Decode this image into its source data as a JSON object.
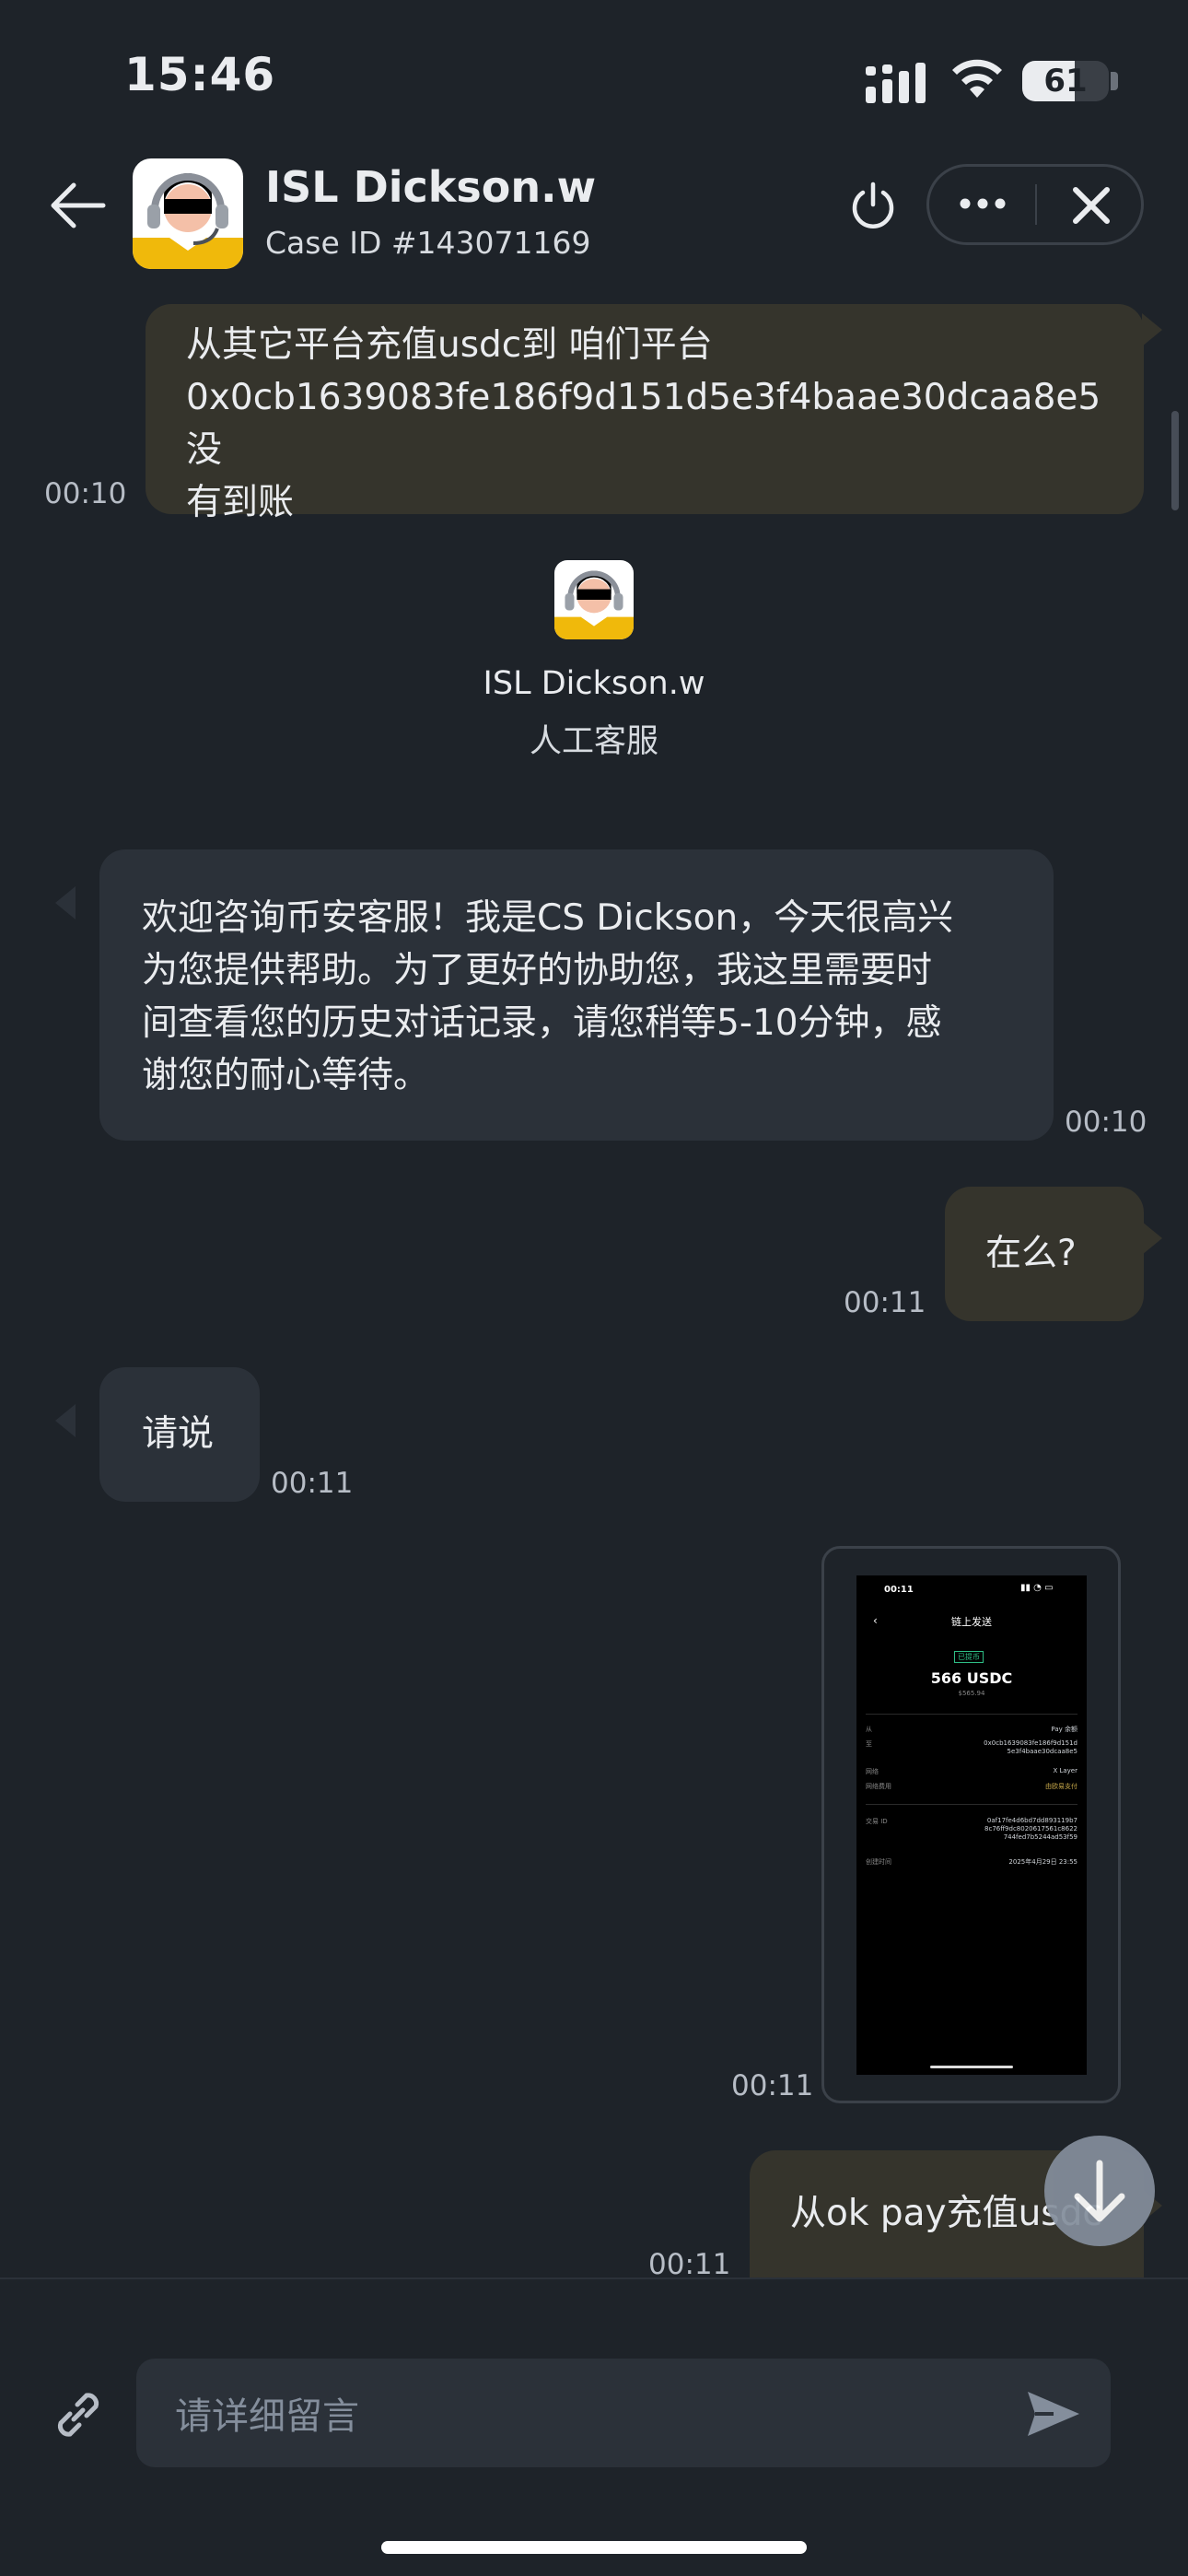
{
  "status_bar": {
    "time": "15:46",
    "battery_percent": 61,
    "battery_label": "61"
  },
  "header": {
    "agent_name": "ISL Dickson.w",
    "case_id": "Case ID #143071169"
  },
  "agent_card": {
    "name": "ISL Dickson.w",
    "role": "人工客服"
  },
  "messages": [
    {
      "direction": "out",
      "text_lines": [
        "从其它平台充值usdc到 咱们平台",
        "0x0cb1639083fe186f9d151d5e3f4baae30dcaa8e5 没",
        "有到账"
      ],
      "time": "00:10"
    },
    {
      "direction": "in",
      "text_lines": [
        "欢迎咨询币安客服！我是CS Dickson，今天很高兴",
        "为您提供帮助。为了更好的协助您，我这里需要时",
        "间查看您的历史对话记录，请您稍等5-10分钟，感",
        "谢您的耐心等待。"
      ],
      "time": "00:10"
    },
    {
      "direction": "out",
      "text": "在么?",
      "time": "00:11"
    },
    {
      "direction": "in",
      "text": "请说",
      "time": "00:11"
    },
    {
      "direction": "out",
      "type": "image",
      "time": "00:11"
    },
    {
      "direction": "out",
      "text": "从ok pay充值usdc",
      "time": "00:11"
    }
  ],
  "image_preview": {
    "time": "00:11",
    "title": "链上发送",
    "badge": "已提币",
    "amount": "566 USDC",
    "fiat": "$565.94",
    "rows": [
      {
        "label": "从",
        "value": "Pay 余额"
      },
      {
        "label": "至",
        "value": "0x0cb1639083fe186f9d151d 5e3f4baae30dcaa8e5"
      },
      {
        "label": "网络",
        "value": "X Layer"
      },
      {
        "label": "网络费用",
        "value": "由欧易支付"
      },
      {
        "label": "交易 ID",
        "value": "0af17fe4d6bd7dd893119b7 8c76ff9dc8020617561c8622 744fed7b5244ad53f59"
      },
      {
        "label": "创建时间",
        "value": "2025年4月29日 23:55"
      }
    ]
  },
  "composer": {
    "placeholder": "请详细留言"
  },
  "colors": {
    "background": "#1e2329",
    "bubble_out": "#35342c",
    "bubble_in": "#2b3139",
    "brand_yellow": "#f0b90b",
    "text": "#eaecef",
    "muted": "#848e9c"
  },
  "icons": [
    "back-arrow-icon",
    "power-icon",
    "more-icon",
    "close-icon",
    "arrow-down-icon",
    "link-icon",
    "send-icon",
    "signal-icon",
    "wifi-icon",
    "battery-icon"
  ]
}
